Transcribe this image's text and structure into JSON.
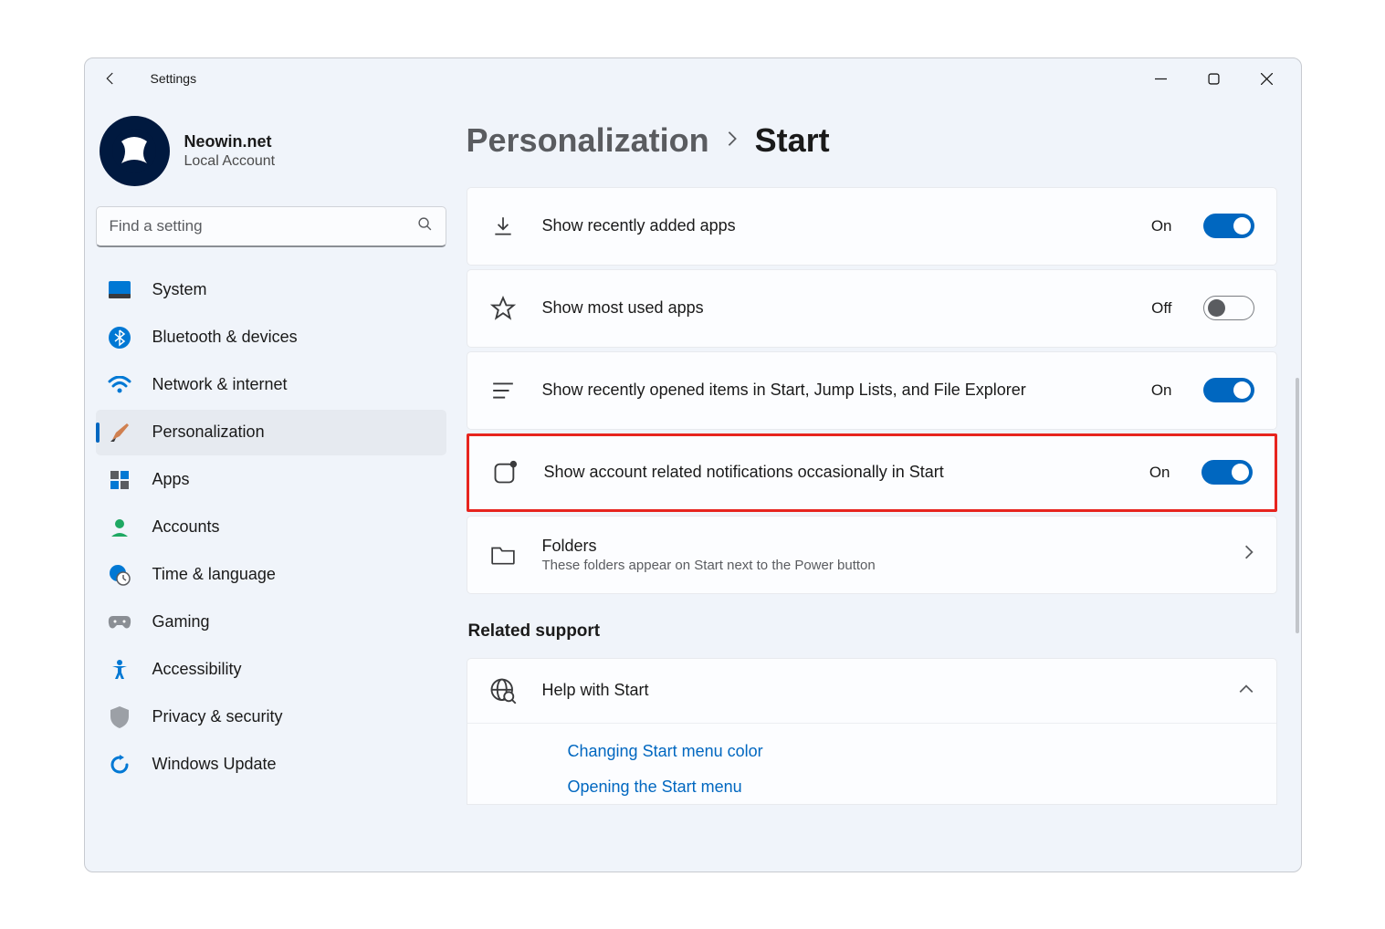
{
  "app_title": "Settings",
  "profile": {
    "name": "Neowin.net",
    "sub": "Local Account"
  },
  "search": {
    "placeholder": "Find a setting"
  },
  "sidebar": {
    "items": [
      {
        "label": "System"
      },
      {
        "label": "Bluetooth & devices"
      },
      {
        "label": "Network & internet"
      },
      {
        "label": "Personalization"
      },
      {
        "label": "Apps"
      },
      {
        "label": "Accounts"
      },
      {
        "label": "Time & language"
      },
      {
        "label": "Gaming"
      },
      {
        "label": "Accessibility"
      },
      {
        "label": "Privacy & security"
      },
      {
        "label": "Windows Update"
      }
    ],
    "active_index": 3
  },
  "breadcrumb": {
    "parent": "Personalization",
    "current": "Start"
  },
  "settings": [
    {
      "label": "Show recently added apps",
      "state": "On",
      "on": true
    },
    {
      "label": "Show most used apps",
      "state": "Off",
      "on": false
    },
    {
      "label": "Show recently opened items in Start, Jump Lists, and File Explorer",
      "state": "On",
      "on": true
    },
    {
      "label": "Show account related notifications occasionally in Start",
      "state": "On",
      "on": true
    }
  ],
  "folders_card": {
    "title": "Folders",
    "sub": "These folders appear on Start next to the Power button"
  },
  "related_support_heading": "Related support",
  "help": {
    "title": "Help with Start",
    "links": [
      "Changing Start menu color",
      "Opening the Start menu"
    ]
  },
  "colors": {
    "accent": "#0067c0",
    "highlight": "#e7241e"
  }
}
